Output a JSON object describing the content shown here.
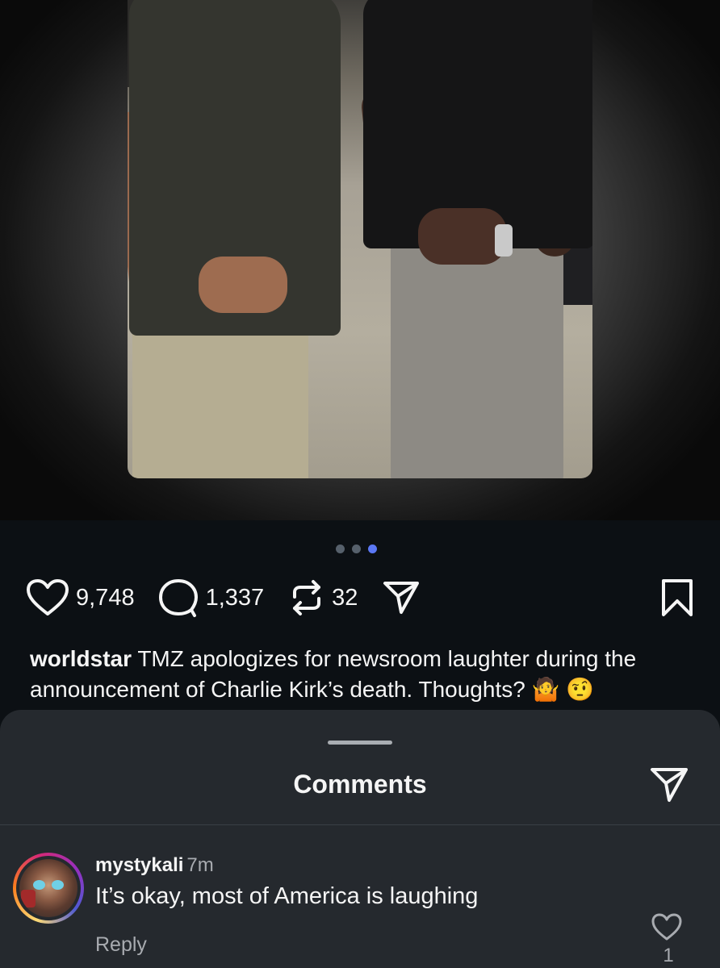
{
  "post": {
    "carousel": {
      "total": 3,
      "active_index": 2
    },
    "actions": {
      "likes": "9,748",
      "comments": "1,337",
      "reposts": "32",
      "icons": [
        "heart-icon",
        "comment-icon",
        "repost-icon",
        "share-icon",
        "bookmark-icon"
      ]
    },
    "caption": {
      "username": "worldstar",
      "text": "TMZ apologizes for newsroom laughter during the announcement of Charlie Kirk’s death. Thoughts? 🤷 🤨"
    }
  },
  "comments_sheet": {
    "title": "Comments",
    "share_icon": "send-icon",
    "comments": [
      {
        "username": "mystykali",
        "time": "7m",
        "text": "It’s okay, most of America is laughing",
        "reply_label": "Reply",
        "like_count": "1"
      }
    ]
  },
  "colors": {
    "background": "#0c1014",
    "sheet": "#25292e",
    "active_dot": "#5b78f5",
    "muted_text": "#a8abb0"
  }
}
